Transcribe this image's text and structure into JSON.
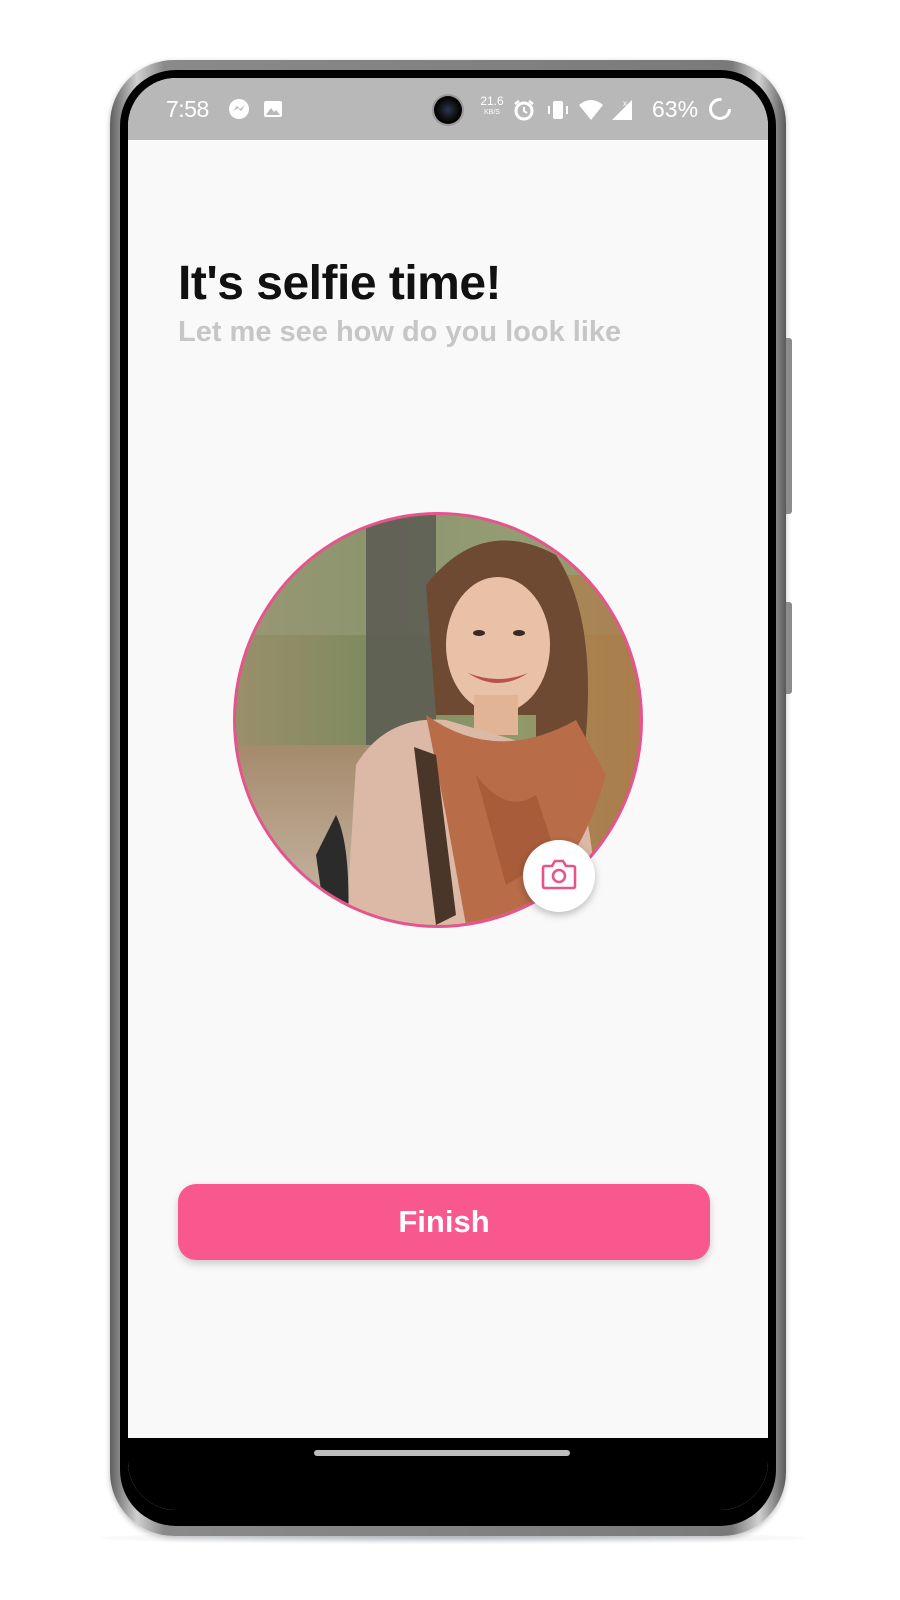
{
  "status_bar": {
    "time": "7:58",
    "net_speed_value": "21.6",
    "net_speed_unit": "KB/S",
    "battery_percent": "63%",
    "icons": [
      "messenger-icon",
      "gallery-icon",
      "front-camera",
      "alarm-icon",
      "vibrate-icon",
      "wifi-icon",
      "signal-icon",
      "battery-charging-icon"
    ]
  },
  "onboarding": {
    "title": "It's selfie time!",
    "subtitle": "Let me see how do you look like"
  },
  "profile_photo": {
    "icon": "camera-icon"
  },
  "actions": {
    "finish_label": "Finish"
  },
  "colors": {
    "accent": "#f8588e",
    "avatar_border": "#e8538e",
    "status_bar": "#b8b8b8",
    "background": "#f9f9f9",
    "subtitle": "#c6c6c6"
  }
}
